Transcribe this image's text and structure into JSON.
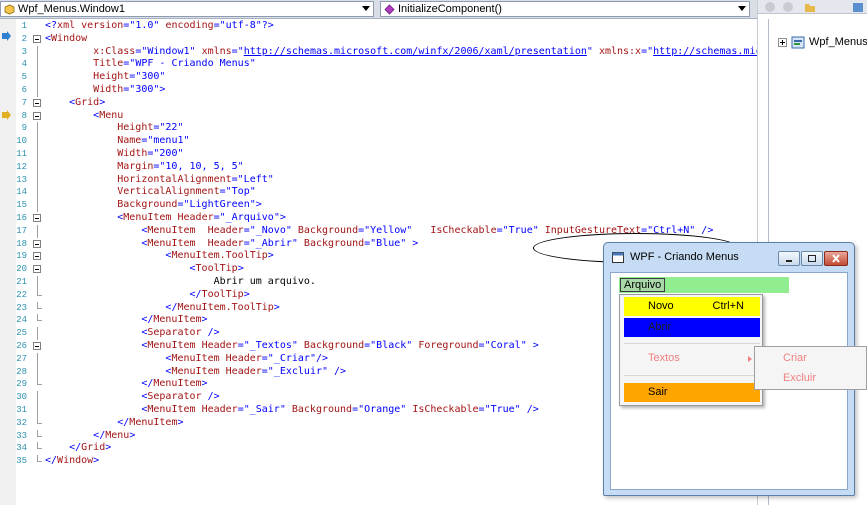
{
  "navbar": {
    "class_combo": "Wpf_Menus.Window1",
    "member_combo": "InitializeComponent()"
  },
  "solution": {
    "project_label": "Wpf_Menus"
  },
  "code_lines": [
    {
      "n": "1",
      "fold": "none",
      "segs": [
        [
          "b",
          "<?"
        ],
        [
          "r",
          "xml"
        ],
        [
          "b",
          " "
        ],
        [
          "r",
          "version"
        ],
        [
          "b",
          "=\"1.0\" "
        ],
        [
          "r",
          "encoding"
        ],
        [
          "b",
          "=\"utf-8\"?>"
        ]
      ]
    },
    {
      "n": "2",
      "fold": "box",
      "segs": [
        [
          "b",
          "<"
        ],
        [
          "r",
          "Window"
        ]
      ]
    },
    {
      "n": "3",
      "fold": "line",
      "segs": [
        [
          "k",
          "        "
        ],
        [
          "r",
          "x:Class"
        ],
        [
          "b",
          "=\"Window1\" "
        ],
        [
          "r",
          "xmlns"
        ],
        [
          "b",
          "=\""
        ],
        [
          "u",
          "http://schemas.microsoft.com/winfx/2006/xaml/presentation"
        ],
        [
          "b",
          "\" "
        ],
        [
          "r",
          "xmlns:x"
        ],
        [
          "b",
          "=\""
        ],
        [
          "u",
          "http://schemas.micro"
        ]
      ]
    },
    {
      "n": "4",
      "fold": "line",
      "segs": [
        [
          "k",
          "        "
        ],
        [
          "r",
          "Title"
        ],
        [
          "b",
          "=\"WPF - Criando Menus\""
        ]
      ]
    },
    {
      "n": "5",
      "fold": "line",
      "segs": [
        [
          "k",
          "        "
        ],
        [
          "r",
          "Height"
        ],
        [
          "b",
          "=\"300\""
        ]
      ]
    },
    {
      "n": "6",
      "fold": "line",
      "segs": [
        [
          "k",
          "        "
        ],
        [
          "r",
          "Width"
        ],
        [
          "b",
          "=\"300\">"
        ]
      ]
    },
    {
      "n": "7",
      "fold": "box",
      "segs": [
        [
          "k",
          "    "
        ],
        [
          "b",
          "<"
        ],
        [
          "r",
          "Grid"
        ],
        [
          "b",
          ">"
        ]
      ]
    },
    {
      "n": "8",
      "fold": "box",
      "segs": [
        [
          "k",
          "        "
        ],
        [
          "b",
          "<"
        ],
        [
          "r",
          "Menu"
        ]
      ]
    },
    {
      "n": "9",
      "fold": "line",
      "segs": [
        [
          "k",
          "            "
        ],
        [
          "r",
          "Height"
        ],
        [
          "b",
          "=\"22\""
        ]
      ]
    },
    {
      "n": "10",
      "fold": "line",
      "segs": [
        [
          "k",
          "            "
        ],
        [
          "r",
          "Name"
        ],
        [
          "b",
          "=\"menu1\""
        ]
      ]
    },
    {
      "n": "11",
      "fold": "line",
      "segs": [
        [
          "k",
          "            "
        ],
        [
          "r",
          "Width"
        ],
        [
          "b",
          "=\"200\""
        ]
      ]
    },
    {
      "n": "12",
      "fold": "line",
      "segs": [
        [
          "k",
          "            "
        ],
        [
          "r",
          "Margin"
        ],
        [
          "b",
          "=\"10, 10, 5, 5\""
        ]
      ]
    },
    {
      "n": "13",
      "fold": "line",
      "segs": [
        [
          "k",
          "            "
        ],
        [
          "r",
          "HorizontalAlignment"
        ],
        [
          "b",
          "=\"Left\""
        ]
      ]
    },
    {
      "n": "14",
      "fold": "line",
      "segs": [
        [
          "k",
          "            "
        ],
        [
          "r",
          "VerticalAlignment"
        ],
        [
          "b",
          "=\"Top\""
        ]
      ]
    },
    {
      "n": "15",
      "fold": "line",
      "segs": [
        [
          "k",
          "            "
        ],
        [
          "r",
          "Background"
        ],
        [
          "b",
          "=\"LightGreen\">"
        ]
      ]
    },
    {
      "n": "16",
      "fold": "box",
      "segs": [
        [
          "k",
          "            "
        ],
        [
          "b",
          "<"
        ],
        [
          "r",
          "MenuItem"
        ],
        [
          "b",
          " "
        ],
        [
          "r",
          "Header"
        ],
        [
          "b",
          "=\"_Arquivo\">"
        ]
      ]
    },
    {
      "n": "17",
      "fold": "line",
      "segs": [
        [
          "k",
          "                "
        ],
        [
          "b",
          "<"
        ],
        [
          "r",
          "MenuItem"
        ],
        [
          "b",
          "  "
        ],
        [
          "r",
          "Header"
        ],
        [
          "b",
          "=\"_Novo\" "
        ],
        [
          "r",
          "Background"
        ],
        [
          "b",
          "=\"Yellow\"   "
        ],
        [
          "r",
          "IsCheckable"
        ],
        [
          "b",
          "=\"True\" "
        ],
        [
          "r",
          "InputGestureText"
        ],
        [
          "b",
          "=\"Ctrl+N\" />"
        ]
      ]
    },
    {
      "n": "18",
      "fold": "box",
      "segs": [
        [
          "k",
          "                "
        ],
        [
          "b",
          "<"
        ],
        [
          "r",
          "MenuItem"
        ],
        [
          "b",
          "  "
        ],
        [
          "r",
          "Header"
        ],
        [
          "b",
          "=\"_Abrir\" "
        ],
        [
          "r",
          "Background"
        ],
        [
          "b",
          "=\"Blue\" >"
        ]
      ]
    },
    {
      "n": "19",
      "fold": "box",
      "segs": [
        [
          "k",
          "                    "
        ],
        [
          "b",
          "<"
        ],
        [
          "r",
          "MenuItem.ToolTip"
        ],
        [
          "b",
          ">"
        ]
      ]
    },
    {
      "n": "20",
      "fold": "box",
      "segs": [
        [
          "k",
          "                        "
        ],
        [
          "b",
          "<"
        ],
        [
          "r",
          "ToolTip"
        ],
        [
          "b",
          ">"
        ]
      ]
    },
    {
      "n": "21",
      "fold": "line",
      "segs": [
        [
          "k",
          "                            Abrir um arquivo."
        ]
      ]
    },
    {
      "n": "22",
      "fold": "end",
      "segs": [
        [
          "k",
          "                        "
        ],
        [
          "b",
          "</"
        ],
        [
          "r",
          "ToolTip"
        ],
        [
          "b",
          ">"
        ]
      ]
    },
    {
      "n": "23",
      "fold": "end",
      "segs": [
        [
          "k",
          "                    "
        ],
        [
          "b",
          "</"
        ],
        [
          "r",
          "MenuItem.ToolTip"
        ],
        [
          "b",
          ">"
        ]
      ]
    },
    {
      "n": "24",
      "fold": "end",
      "segs": [
        [
          "k",
          "                "
        ],
        [
          "b",
          "</"
        ],
        [
          "r",
          "MenuItem"
        ],
        [
          "b",
          ">"
        ]
      ]
    },
    {
      "n": "25",
      "fold": "line",
      "segs": [
        [
          "k",
          "                "
        ],
        [
          "b",
          "<"
        ],
        [
          "r",
          "Separator"
        ],
        [
          "b",
          " />"
        ]
      ]
    },
    {
      "n": "26",
      "fold": "box",
      "segs": [
        [
          "k",
          "                "
        ],
        [
          "b",
          "<"
        ],
        [
          "r",
          "MenuItem"
        ],
        [
          "b",
          " "
        ],
        [
          "r",
          "Header"
        ],
        [
          "b",
          "=\"_Textos\" "
        ],
        [
          "r",
          "Background"
        ],
        [
          "b",
          "=\"Black\" "
        ],
        [
          "r",
          "Foreground"
        ],
        [
          "b",
          "=\"Coral\" >"
        ]
      ]
    },
    {
      "n": "27",
      "fold": "line",
      "segs": [
        [
          "k",
          "                    "
        ],
        [
          "b",
          "<"
        ],
        [
          "r",
          "MenuItem"
        ],
        [
          "b",
          " "
        ],
        [
          "r",
          "Header"
        ],
        [
          "b",
          "=\"_Criar\"/>"
        ]
      ]
    },
    {
      "n": "28",
      "fold": "line",
      "segs": [
        [
          "k",
          "                    "
        ],
        [
          "b",
          "<"
        ],
        [
          "r",
          "MenuItem"
        ],
        [
          "b",
          " "
        ],
        [
          "r",
          "Header"
        ],
        [
          "b",
          "=\"_Excluir\" />"
        ]
      ]
    },
    {
      "n": "29",
      "fold": "end",
      "segs": [
        [
          "k",
          "                "
        ],
        [
          "b",
          "</"
        ],
        [
          "r",
          "MenuItem"
        ],
        [
          "b",
          ">"
        ]
      ]
    },
    {
      "n": "30",
      "fold": "line",
      "segs": [
        [
          "k",
          "                "
        ],
        [
          "b",
          "<"
        ],
        [
          "r",
          "Separator"
        ],
        [
          "b",
          " />"
        ]
      ]
    },
    {
      "n": "31",
      "fold": "line",
      "segs": [
        [
          "k",
          "                "
        ],
        [
          "b",
          "<"
        ],
        [
          "r",
          "MenuItem"
        ],
        [
          "b",
          " "
        ],
        [
          "r",
          "Header"
        ],
        [
          "b",
          "=\"_Sair\" "
        ],
        [
          "r",
          "Background"
        ],
        [
          "b",
          "=\"Orange\" "
        ],
        [
          "r",
          "IsCheckable"
        ],
        [
          "b",
          "=\"True\" />"
        ]
      ]
    },
    {
      "n": "32",
      "fold": "end",
      "segs": [
        [
          "k",
          "            "
        ],
        [
          "b",
          "</"
        ],
        [
          "r",
          "MenuItem"
        ],
        [
          "b",
          ">"
        ]
      ]
    },
    {
      "n": "33",
      "fold": "end",
      "segs": [
        [
          "k",
          "        "
        ],
        [
          "b",
          "</"
        ],
        [
          "r",
          "Menu"
        ],
        [
          "b",
          ">"
        ]
      ]
    },
    {
      "n": "34",
      "fold": "end",
      "segs": [
        [
          "k",
          "    "
        ],
        [
          "b",
          "</"
        ],
        [
          "r",
          "Grid"
        ],
        [
          "b",
          ">"
        ]
      ]
    },
    {
      "n": "35",
      "fold": "end",
      "segs": [
        [
          "b",
          "</"
        ],
        [
          "r",
          "Window"
        ],
        [
          "b",
          ">"
        ]
      ]
    }
  ],
  "preview_window": {
    "title": "WPF - Criando Menus",
    "menu_top": "Arquivo",
    "items": {
      "novo": "Novo",
      "novo_gesture": "Ctrl+N",
      "abrir": "Abrir",
      "textos": "Textos",
      "sair": "Sair"
    },
    "submenu": {
      "criar": "Criar",
      "excluir": "Excluir"
    }
  },
  "colors": {
    "menu_bar": "#90ee90",
    "novo_bg": "#ffff00",
    "abrir_bg": "#0000ff",
    "sair_bg": "#ffa500",
    "coral_text": "#f08080"
  }
}
